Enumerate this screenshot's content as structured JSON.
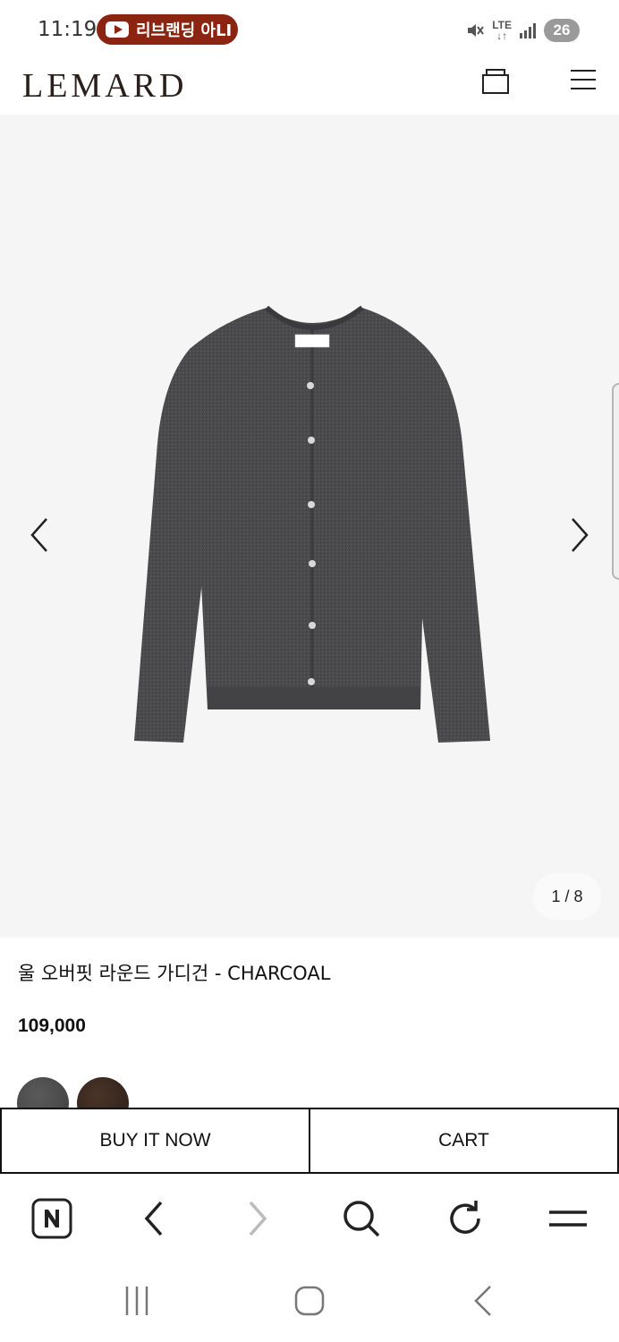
{
  "status_bar": {
    "time": "11:19",
    "notification_text": "리브랜딩 아LI",
    "network": "LTE",
    "battery": "26"
  },
  "header": {
    "logo": "LEMARD"
  },
  "gallery": {
    "counter": "1 / 8",
    "current": 1,
    "total": 8
  },
  "product": {
    "name": "울 오버핏 라운드 가디건 - CHARCOAL",
    "price": "109,000",
    "colors": [
      "#4a4a4a",
      "#2f211b"
    ]
  },
  "actions": {
    "buy_now": "BUY IT NOW",
    "cart": "CART"
  },
  "icons": {
    "bag": "shopping-bag-icon",
    "menu": "hamburger-menu-icon",
    "prev": "chevron-left-icon",
    "next": "chevron-right-icon",
    "naver": "naver-n-icon",
    "back": "back-arrow-icon",
    "forward": "forward-arrow-icon",
    "search": "search-icon",
    "reload": "reload-icon",
    "browser_menu": "menu-icon",
    "recent_apps": "recent-apps-icon",
    "home": "home-icon",
    "system_back": "system-back-icon"
  }
}
